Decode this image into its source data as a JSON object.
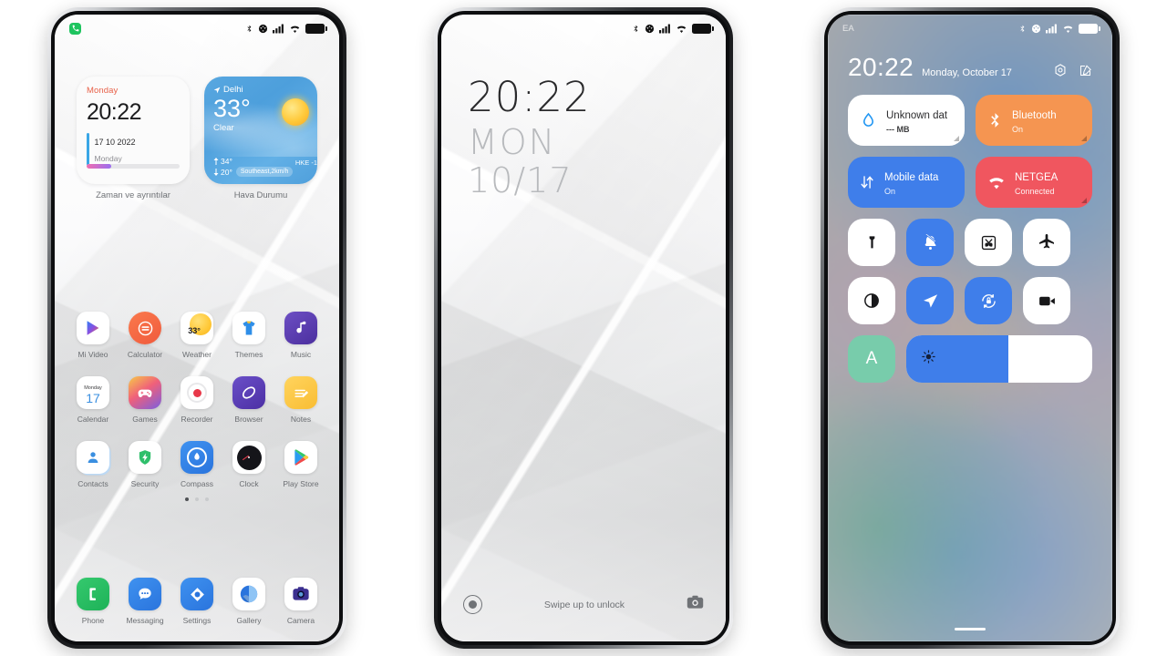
{
  "phone_home": {
    "status_bar": {
      "notification_icon": "phone-call-icon",
      "icons": [
        "bluetooth-icon",
        "vpn-icon",
        "signal-bars-icon",
        "wifi-icon",
        "battery-icon"
      ]
    },
    "widgets": [
      {
        "type": "clock",
        "name": "time-and-details-widget",
        "day": "Monday",
        "time": "20:22",
        "date": "17 10 2022",
        "weekday": "Monday",
        "progress_pct": 26,
        "label": "Zaman ve ayrıntılar"
      },
      {
        "type": "weather",
        "name": "weather-widget",
        "city": "Delhi",
        "temp": "33°",
        "condition": "Clear",
        "high": "34°",
        "low": "20°",
        "wind": "Southeast,2km/h",
        "aqi": "HKE -1",
        "label": "Hava Durumu"
      }
    ],
    "app_rows": [
      [
        {
          "name": "Mi Video",
          "icon": "mi-video-icon"
        },
        {
          "name": "Calculator",
          "icon": "calculator-icon"
        },
        {
          "name": "Weather",
          "icon": "weather-icon",
          "badge": "33°"
        },
        {
          "name": "Themes",
          "icon": "themes-icon"
        },
        {
          "name": "Music",
          "icon": "music-icon"
        }
      ],
      [
        {
          "name": "Calendar",
          "icon": "calendar-icon",
          "badge": "Monday",
          "badge2": "17"
        },
        {
          "name": "Games",
          "icon": "games-icon"
        },
        {
          "name": "Recorder",
          "icon": "recorder-icon"
        },
        {
          "name": "Browser",
          "icon": "browser-icon"
        },
        {
          "name": "Notes",
          "icon": "notes-icon"
        }
      ],
      [
        {
          "name": "Contacts",
          "icon": "contacts-icon"
        },
        {
          "name": "Security",
          "icon": "security-icon"
        },
        {
          "name": "Compass",
          "icon": "compass-icon"
        },
        {
          "name": "Clock",
          "icon": "clock-icon"
        },
        {
          "name": "Play Store",
          "icon": "play-store-icon"
        }
      ]
    ],
    "page_dots": {
      "total": 3,
      "active": 1
    },
    "dock": [
      {
        "name": "Phone",
        "icon": "phone-icon"
      },
      {
        "name": "Messaging",
        "icon": "messaging-icon"
      },
      {
        "name": "Settings",
        "icon": "settings-icon"
      },
      {
        "name": "Gallery",
        "icon": "gallery-icon"
      },
      {
        "name": "Camera",
        "icon": "camera-icon"
      }
    ]
  },
  "phone_lock": {
    "status_bar": {
      "icons": [
        "bluetooth-icon",
        "vpn-icon",
        "signal-bars-icon",
        "wifi-icon",
        "battery-icon"
      ]
    },
    "time": "20:22",
    "weekday": "MON",
    "date": "10/17",
    "hint": "Swipe up to unlock",
    "left_shortcut": "flashlight-toggle-icon",
    "right_shortcut": "camera-shortcut-icon"
  },
  "phone_quicksettings": {
    "carrier": "EA",
    "status_bar": {
      "icons": [
        "bluetooth-icon",
        "vpn-icon",
        "signal-bars-icon",
        "wifi-icon",
        "battery-icon"
      ]
    },
    "time": "20:22",
    "date": "Monday, October 17",
    "header_icons": [
      "settings-gear-icon",
      "edit-icon"
    ],
    "wide_tiles": [
      {
        "name": "data-usage-tile",
        "icon": "data-drop-icon",
        "title": "Unknown dat",
        "subtitle": "--- MB",
        "bg": "#ffffff",
        "fg": "#2c2c2e",
        "icon_color": "#2196f3"
      },
      {
        "name": "bluetooth-tile",
        "icon": "bluetooth-icon",
        "title": "Bluetooth",
        "subtitle": "On",
        "bg": "#f59551",
        "fg": "#ffffff",
        "icon_color": "#ffffff"
      },
      {
        "name": "mobile-data-tile",
        "icon": "mobile-data-icon",
        "title": "Mobile data",
        "subtitle": "On",
        "bg": "#3f7eea",
        "fg": "#ffffff",
        "icon_color": "#ffffff"
      },
      {
        "name": "wifi-tile",
        "icon": "wifi-icon",
        "title": "NETGEA",
        "subtitle": "Connected",
        "bg": "#f0565f",
        "fg": "#ffffff",
        "icon_color": "#ffffff"
      }
    ],
    "toggle_rows": [
      [
        {
          "name": "flashlight-toggle",
          "icon": "flashlight-icon",
          "on": false
        },
        {
          "name": "silent-toggle",
          "icon": "bell-off-icon",
          "on": true
        },
        {
          "name": "screenshot-toggle",
          "icon": "screenshot-icon",
          "on": false
        },
        {
          "name": "airplane-toggle",
          "icon": "airplane-icon",
          "on": false
        }
      ],
      [
        {
          "name": "dark-mode-toggle",
          "icon": "dark-mode-icon",
          "on": false
        },
        {
          "name": "location-toggle",
          "icon": "location-icon",
          "on": true
        },
        {
          "name": "rotation-toggle",
          "icon": "rotation-lock-icon",
          "on": true
        },
        {
          "name": "screen-record-toggle",
          "icon": "video-camera-icon",
          "on": false
        }
      ]
    ],
    "auto_brightness": {
      "name": "auto-brightness-toggle",
      "label": "A",
      "color": "#78ccab"
    },
    "brightness": {
      "name": "brightness-slider",
      "icon": "brightness-sun-icon",
      "value_pct": 55,
      "fill": "#3f7eea"
    }
  },
  "colors": {
    "accent_blue": "#3f7eea",
    "orange": "#f59551",
    "red": "#f0565f",
    "green": "#78ccab",
    "text_muted": "#6b6e72"
  }
}
